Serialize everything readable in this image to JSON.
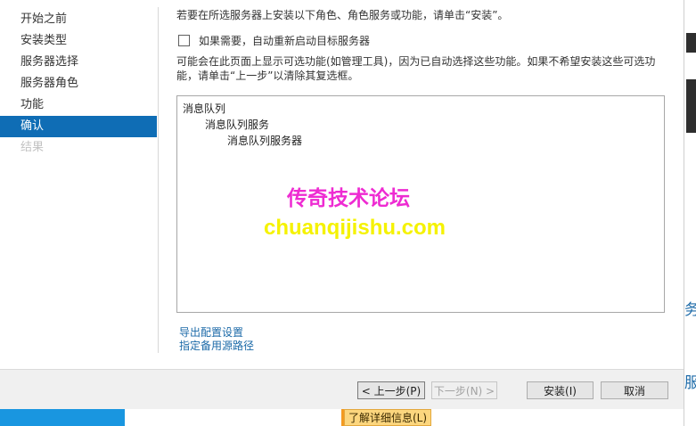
{
  "nav": {
    "items": [
      {
        "label": "开始之前",
        "state": "normal"
      },
      {
        "label": "安装类型",
        "state": "normal"
      },
      {
        "label": "服务器选择",
        "state": "normal"
      },
      {
        "label": "服务器角色",
        "state": "normal"
      },
      {
        "label": "功能",
        "state": "normal"
      },
      {
        "label": "确认",
        "state": "active"
      },
      {
        "label": "结果",
        "state": "disabled"
      }
    ]
  },
  "main": {
    "heading": "若要在所选服务器上安装以下角色、角色服务或功能，请单击“安装”。",
    "restart_label": "如果需要，自动重新启动目标服务器",
    "restart_checked": false,
    "notice": "可能会在此页面上显示可选功能(如管理工具)，因为已自动选择这些功能。如果不希望安装这些可选功能，请单击“上一步”以清除其复选框。",
    "tree": [
      {
        "label": "消息队列",
        "level": 1
      },
      {
        "label": "消息队列服务",
        "level": 2
      },
      {
        "label": "消息队列服务器",
        "level": 3
      }
    ],
    "watermark_cn": "传奇技术论坛",
    "watermark_url": "chuanqijishu.com",
    "links": {
      "export": "导出配置设置",
      "alt_source": "指定备用源路径"
    }
  },
  "footer": {
    "prev_label": "< 上一步(P)",
    "next_label": "下一步(N) >",
    "install_label": "安装(I)",
    "cancel_label": "取消"
  },
  "taskstrip": {
    "learn_more": "了解详细信息(L)"
  },
  "right_edge": {
    "char1": "务",
    "char2": "服"
  },
  "colors": {
    "accent": "#0f6db5",
    "link": "#1c6aa8",
    "watermark_pink": "#ee2bd2",
    "watermark_yellow": "#f5f200",
    "taskbar_blue": "#1996e0",
    "notice_orange": "#fcd67e"
  }
}
